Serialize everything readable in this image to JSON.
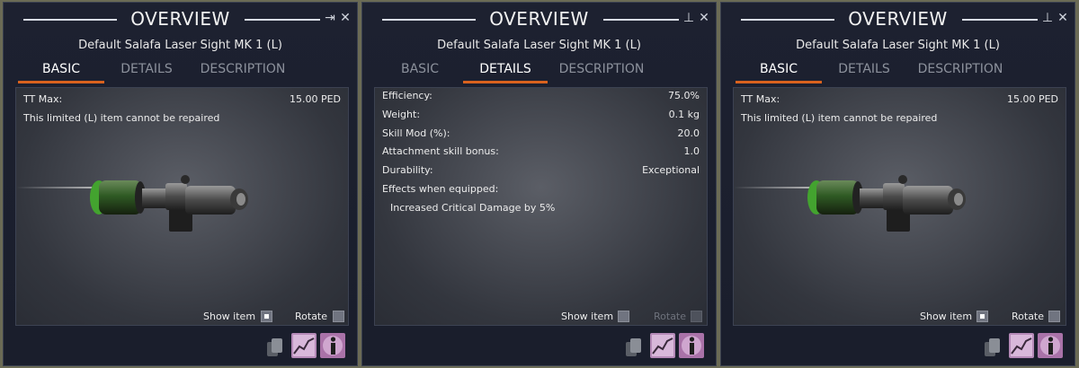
{
  "colors": {
    "accent": "#d9621e",
    "panel_bg": "#1d2130",
    "stats_icon": "#b58ab8",
    "info_icon": "#a972a8"
  },
  "panels": [
    {
      "title": "OVERVIEW",
      "item_name": "Default Salafa Laser Sight MK 1 (L)",
      "tabs": [
        "BASIC",
        "DETAILS",
        "DESCRIPTION"
      ],
      "active_tab": "BASIC",
      "tt_max_label": "TT Max:",
      "tt_max_value": "15.00 PED",
      "repair_note": "This limited (L) item cannot be repaired",
      "show_item_label": "Show item",
      "show_item_checked": true,
      "rotate_label": "Rotate"
    },
    {
      "title": "OVERVIEW",
      "item_name": "Default Salafa Laser Sight MK 1 (L)",
      "tabs": [
        "BASIC",
        "DETAILS",
        "DESCRIPTION"
      ],
      "active_tab": "DETAILS",
      "details": [
        {
          "label": "Efficiency:",
          "value": "75.0%"
        },
        {
          "label": "Weight:",
          "value": "0.1 kg"
        },
        {
          "label": "Skill Mod (%):",
          "value": "20.0"
        },
        {
          "label": "Attachment skill bonus:",
          "value": "1.0"
        },
        {
          "label": "Durability:",
          "value": "Exceptional"
        }
      ],
      "effects_label": "Effects when equipped:",
      "effect": "Increased Critical Damage by 5%",
      "show_item_label": "Show item",
      "show_item_checked": false,
      "rotate_label": "Rotate"
    },
    {
      "title": "OVERVIEW",
      "item_name": "Default Salafa Laser Sight MK 1 (L)",
      "tabs": [
        "BASIC",
        "DETAILS",
        "DESCRIPTION"
      ],
      "active_tab": "BASIC",
      "tt_max_label": "TT Max:",
      "tt_max_value": "15.00 PED",
      "repair_note": "This limited (L) item cannot be repaired",
      "show_item_label": "Show item",
      "show_item_checked": true,
      "rotate_label": "Rotate"
    }
  ],
  "icons": {
    "pin": "pin-icon",
    "close": "close-icon",
    "copy": "copy-icon",
    "stats": "stats-chart-icon",
    "info": "info-icon"
  }
}
